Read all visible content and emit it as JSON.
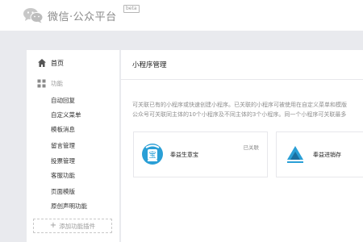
{
  "header": {
    "logo_icon": "wechat-logo-icon",
    "title": "微信·公众平台",
    "beta": "beta"
  },
  "sidebar": {
    "home": {
      "label": "首页",
      "icon": "home-icon"
    },
    "function_group": {
      "label": "功能",
      "icon": "grid-icon"
    },
    "items": [
      {
        "label": "自动回复"
      },
      {
        "label": "自定义菜单"
      },
      {
        "label": "模板消息"
      },
      {
        "label": "留言管理"
      },
      {
        "label": "投票管理"
      },
      {
        "label": "客服功能"
      },
      {
        "label": "页面模版"
      },
      {
        "label": "原创声明功能"
      }
    ],
    "add_plugin": {
      "icon": "+",
      "label": "添加功能插件"
    }
  },
  "main": {
    "title": "小程序管理",
    "description": [
      "可关联已有的小程序或快速创建小程序。已关联的小程序可被使用在自定义菜单和模版",
      "公众号可关联同主体的10个小程序及不同主体的3个小程序。同一个小程序可关联最多"
    ],
    "apps": [
      {
        "name": "奉益生意宝",
        "status": "已关联",
        "icon": "bao-app-icon",
        "color": "#2a9fd6"
      },
      {
        "name": "奉益进销存",
        "icon": "triangle-app-icon",
        "color": "#2a9fd6"
      }
    ]
  }
}
